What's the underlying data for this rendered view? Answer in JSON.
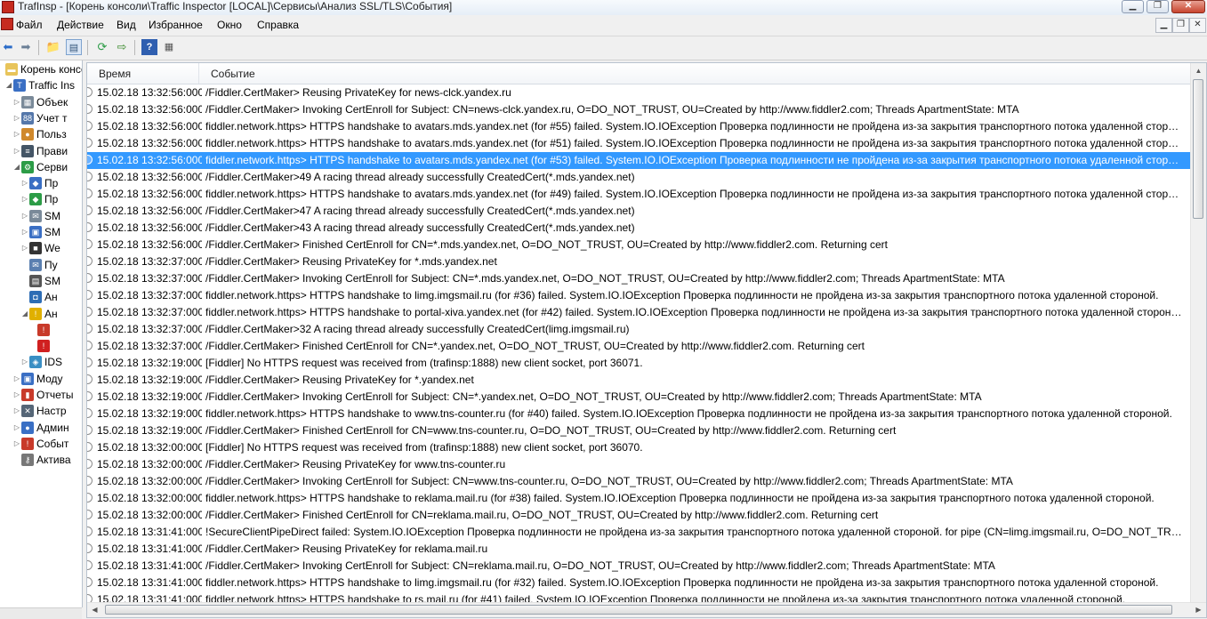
{
  "window": {
    "title": "TrafInsp - [Корень консоли\\Traffic Inspector [LOCAL]\\Сервисы\\Анализ SSL/TLS\\События]"
  },
  "menu": {
    "items": [
      "Файл",
      "Действие",
      "Вид",
      "Избранное",
      "Окно",
      "Справка"
    ]
  },
  "toolbar": {
    "icons": [
      "back-icon",
      "forward-icon",
      "up-folder-icon",
      "show-hide-tree-icon",
      "refresh-icon",
      "export-icon",
      "help-icon",
      "properties-icon"
    ]
  },
  "tree": {
    "items": [
      {
        "label": "Корень консо",
        "icon": "folder-icon",
        "color": "#e8c45a"
      },
      {
        "label": "Traffic Ins",
        "icon": "traffic-inspector-icon",
        "color": "#3a6fc4"
      },
      {
        "label": "Объек",
        "icon": "objects-icon",
        "color": "#7a8a99"
      },
      {
        "label": "Учет т",
        "icon": "accounting-icon",
        "color": "#5577aa"
      },
      {
        "label": "Польз",
        "icon": "users-icon",
        "color": "#d0892c"
      },
      {
        "label": "Прави",
        "icon": "rules-icon",
        "color": "#445566"
      },
      {
        "label": "Серви",
        "icon": "services-icon",
        "color": "#2c9c47"
      },
      {
        "label": "Пр",
        "icon": "proxy-icon",
        "color": "#3a6fc4"
      },
      {
        "label": "Пр",
        "icon": "proxy2-icon",
        "color": "#2c9c47"
      },
      {
        "label": "SM",
        "icon": "smtp-icon",
        "color": "#7a8a99"
      },
      {
        "label": "SM",
        "icon": "smtp2-icon",
        "color": "#3a6fc4"
      },
      {
        "label": "We",
        "icon": "web-icon",
        "color": "#333333"
      },
      {
        "label": "Пу",
        "icon": "mail-icon",
        "color": "#5a7fb0"
      },
      {
        "label": "SM",
        "icon": "sms-icon",
        "color": "#555555"
      },
      {
        "label": "Ан",
        "icon": "analysis-icon",
        "color": "#2d6db5"
      },
      {
        "label": "Ан",
        "icon": "ssl-warning-icon",
        "color": "#e0b000"
      },
      {
        "label": "",
        "icon": "events-log-icon",
        "color": "#c83a2a"
      },
      {
        "label": "",
        "icon": "error-icon",
        "color": "#d02020"
      },
      {
        "label": "IDS",
        "icon": "ids-shield-icon",
        "color": "#3a8fc4"
      },
      {
        "label": "Моду",
        "icon": "modules-icon",
        "color": "#3a6fc4"
      },
      {
        "label": "Отчеты",
        "icon": "reports-icon",
        "color": "#c83a2a"
      },
      {
        "label": "Настр",
        "icon": "settings-tools-icon",
        "color": "#556677"
      },
      {
        "label": "Админ",
        "icon": "admin-icon",
        "color": "#3a6fc4"
      },
      {
        "label": "Событ",
        "icon": "events-icon",
        "color": "#c83a2a"
      },
      {
        "label": "Актива",
        "icon": "activation-key-icon",
        "color": "#777777"
      }
    ]
  },
  "list": {
    "columns": [
      "Время",
      "Событие"
    ],
    "selected_index": 4,
    "rows": [
      {
        "time": "15.02.18 13:32:56:000",
        "event": "/Fiddler.CertMaker> Reusing PrivateKey for news-clck.yandex.ru"
      },
      {
        "time": "15.02.18 13:32:56:000",
        "event": "/Fiddler.CertMaker> Invoking CertEnroll for Subject: CN=news-clck.yandex.ru, O=DO_NOT_TRUST, OU=Created by http://www.fiddler2.com; Threads ApartmentState: MTA"
      },
      {
        "time": "15.02.18 13:32:56:000",
        "event": "fiddler.network.https> HTTPS handshake to avatars.mds.yandex.net (for #55) failed. System.IO.IOException Проверка подлинности не пройдена из-за закрытия транспортного потока удаленной стороно..."
      },
      {
        "time": "15.02.18 13:32:56:000",
        "event": "fiddler.network.https> HTTPS handshake to avatars.mds.yandex.net (for #51) failed. System.IO.IOException Проверка подлинности не пройдена из-за закрытия транспортного потока удаленной стороно..."
      },
      {
        "time": "15.02.18 13:32:56:000",
        "event": "fiddler.network.https> HTTPS handshake to avatars.mds.yandex.net (for #53) failed. System.IO.IOException Проверка подлинности не пройдена из-за закрытия транспортного потока удаленной стороно..."
      },
      {
        "time": "15.02.18 13:32:56:000",
        "event": "/Fiddler.CertMaker>49 A racing thread already successfully CreatedCert(*.mds.yandex.net)"
      },
      {
        "time": "15.02.18 13:32:56:000",
        "event": "fiddler.network.https> HTTPS handshake to avatars.mds.yandex.net (for #49) failed. System.IO.IOException Проверка подлинности не пройдена из-за закрытия транспортного потока удаленной стороно..."
      },
      {
        "time": "15.02.18 13:32:56:000",
        "event": "/Fiddler.CertMaker>47 A racing thread already successfully CreatedCert(*.mds.yandex.net)"
      },
      {
        "time": "15.02.18 13:32:56:000",
        "event": "/Fiddler.CertMaker>43 A racing thread already successfully CreatedCert(*.mds.yandex.net)"
      },
      {
        "time": "15.02.18 13:32:56:000",
        "event": "/Fiddler.CertMaker> Finished CertEnroll for CN=*.mds.yandex.net, O=DO_NOT_TRUST, OU=Created by http://www.fiddler2.com. Returning cert"
      },
      {
        "time": "15.02.18 13:32:37:000",
        "event": "/Fiddler.CertMaker> Reusing PrivateKey for *.mds.yandex.net"
      },
      {
        "time": "15.02.18 13:32:37:000",
        "event": "/Fiddler.CertMaker> Invoking CertEnroll for Subject: CN=*.mds.yandex.net, O=DO_NOT_TRUST, OU=Created by http://www.fiddler2.com; Threads ApartmentState: MTA"
      },
      {
        "time": "15.02.18 13:32:37:000",
        "event": "fiddler.network.https> HTTPS handshake to limg.imgsmail.ru (for #36) failed. System.IO.IOException Проверка подлинности не пройдена из-за закрытия транспортного потока удаленной стороной."
      },
      {
        "time": "15.02.18 13:32:37:000",
        "event": "fiddler.network.https> HTTPS handshake to portal-xiva.yandex.net (for #42) failed. System.IO.IOException Проверка подлинности не пройдена из-за закрытия транспортного потока удаленной стороной."
      },
      {
        "time": "15.02.18 13:32:37:000",
        "event": "/Fiddler.CertMaker>32 A racing thread already successfully CreatedCert(limg.imgsmail.ru)"
      },
      {
        "time": "15.02.18 13:32:37:000",
        "event": "/Fiddler.CertMaker> Finished CertEnroll for CN=*.yandex.net, O=DO_NOT_TRUST, OU=Created by http://www.fiddler2.com. Returning cert"
      },
      {
        "time": "15.02.18 13:32:19:000",
        "event": "[Fiddler] No HTTPS request was received from (trafinsp:1888) new client socket, port 36071."
      },
      {
        "time": "15.02.18 13:32:19:000",
        "event": "/Fiddler.CertMaker> Reusing PrivateKey for *.yandex.net"
      },
      {
        "time": "15.02.18 13:32:19:000",
        "event": "/Fiddler.CertMaker> Invoking CertEnroll for Subject: CN=*.yandex.net, O=DO_NOT_TRUST, OU=Created by http://www.fiddler2.com; Threads ApartmentState: MTA"
      },
      {
        "time": "15.02.18 13:32:19:000",
        "event": "fiddler.network.https> HTTPS handshake to www.tns-counter.ru (for #40) failed. System.IO.IOException Проверка подлинности не пройдена из-за закрытия транспортного потока удаленной стороной."
      },
      {
        "time": "15.02.18 13:32:19:000",
        "event": "/Fiddler.CertMaker> Finished CertEnroll for CN=www.tns-counter.ru, O=DO_NOT_TRUST, OU=Created by http://www.fiddler2.com. Returning cert"
      },
      {
        "time": "15.02.18 13:32:00:000",
        "event": "[Fiddler] No HTTPS request was received from (trafinsp:1888) new client socket, port 36070."
      },
      {
        "time": "15.02.18 13:32:00:000",
        "event": "/Fiddler.CertMaker> Reusing PrivateKey for www.tns-counter.ru"
      },
      {
        "time": "15.02.18 13:32:00:000",
        "event": "/Fiddler.CertMaker> Invoking CertEnroll for Subject: CN=www.tns-counter.ru, O=DO_NOT_TRUST, OU=Created by http://www.fiddler2.com; Threads ApartmentState: MTA"
      },
      {
        "time": "15.02.18 13:32:00:000",
        "event": "fiddler.network.https> HTTPS handshake to reklama.mail.ru (for #38) failed. System.IO.IOException Проверка подлинности не пройдена из-за закрытия транспортного потока удаленной стороной."
      },
      {
        "time": "15.02.18 13:32:00:000",
        "event": "/Fiddler.CertMaker> Finished CertEnroll for CN=reklama.mail.ru, O=DO_NOT_TRUST, OU=Created by http://www.fiddler2.com. Returning cert"
      },
      {
        "time": "15.02.18 13:31:41:000",
        "event": "!SecureClientPipeDirect failed: System.IO.IOException Проверка подлинности не пройдена из-за закрытия транспортного потока удаленной стороной. for pipe (CN=limg.imgsmail.ru, O=DO_NOT_TRUS..."
      },
      {
        "time": "15.02.18 13:31:41:000",
        "event": "/Fiddler.CertMaker> Reusing PrivateKey for reklama.mail.ru"
      },
      {
        "time": "15.02.18 13:31:41:000",
        "event": "/Fiddler.CertMaker> Invoking CertEnroll for Subject: CN=reklama.mail.ru, O=DO_NOT_TRUST, OU=Created by http://www.fiddler2.com; Threads ApartmentState: MTA"
      },
      {
        "time": "15.02.18 13:31:41:000",
        "event": "fiddler.network.https> HTTPS handshake to limg.imgsmail.ru (for #32) failed. System.IO.IOException Проверка подлинности не пройдена из-за закрытия транспортного потока удаленной стороной."
      },
      {
        "time": "15.02.18 13:31:41:000",
        "event": "fiddler.network.https> HTTPS handshake to rs.mail.ru (for #41) failed. System.IO.IOException Проверка подлинности не пройдена из-за закрытия транспортного потока удаленной стороной."
      }
    ]
  },
  "colors": {
    "selection": "#3399ff",
    "title_bar": "#e6eef7"
  }
}
